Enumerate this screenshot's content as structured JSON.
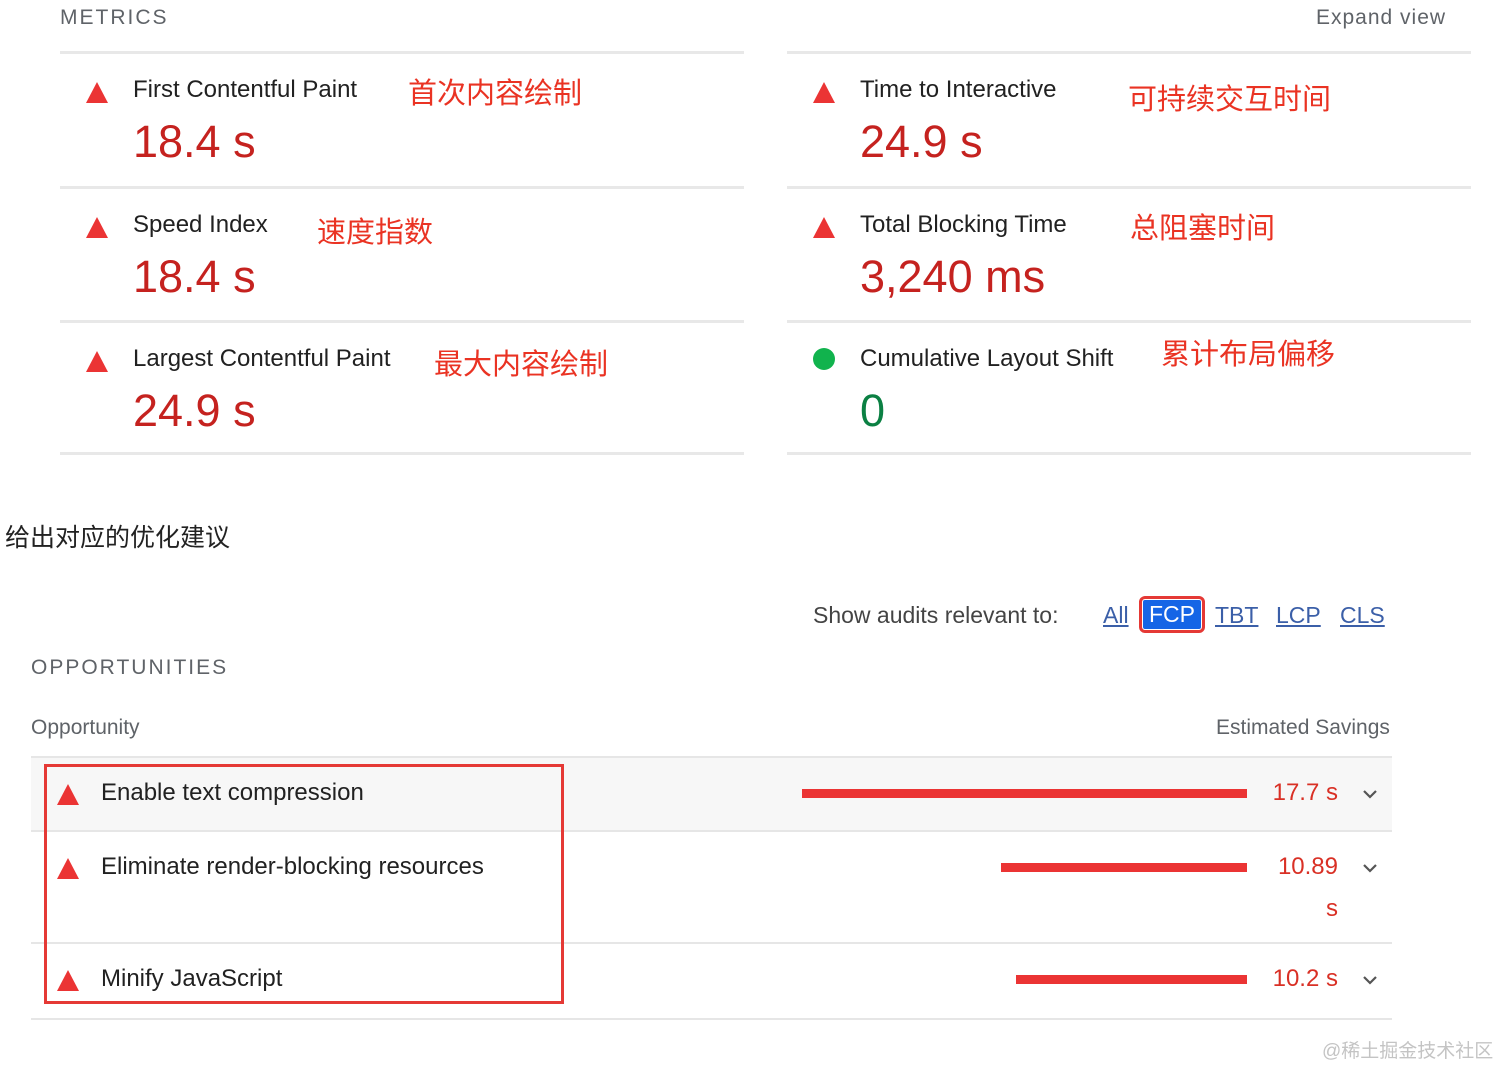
{
  "metrics_section": {
    "title": "METRICS",
    "expand_label": "Expand view",
    "items": [
      {
        "name": "First Contentful Paint",
        "value": "18.4 s",
        "status": "fail",
        "annotation": "首次内容绘制"
      },
      {
        "name": "Time to Interactive",
        "value": "24.9 s",
        "status": "fail",
        "annotation": "可持续交互时间"
      },
      {
        "name": "Speed Index",
        "value": "18.4 s",
        "status": "fail",
        "annotation": "速度指数"
      },
      {
        "name": "Total Blocking Time",
        "value": "3,240 ms",
        "status": "fail",
        "annotation": "总阻塞时间"
      },
      {
        "name": "Largest Contentful Paint",
        "value": "24.9 s",
        "status": "fail",
        "annotation": "最大内容绘制"
      },
      {
        "name": "Cumulative Layout Shift",
        "value": "0",
        "status": "pass",
        "annotation": "累计布局偏移"
      }
    ]
  },
  "note": "给出对应的优化建议",
  "audit_filter": {
    "label": "Show audits relevant to:",
    "options": [
      "All",
      "FCP",
      "TBT",
      "LCP",
      "CLS"
    ],
    "selected": "FCP"
  },
  "opportunities": {
    "title": "OPPORTUNITIES",
    "column_opportunity": "Opportunity",
    "column_savings": "Estimated Savings",
    "rows": [
      {
        "label": "Enable text compression",
        "savings": "17.7 s",
        "savings_value": 17.7
      },
      {
        "label": "Eliminate render-blocking resources",
        "savings": "10.89 s",
        "savings_value": 10.89
      },
      {
        "label": "Minify JavaScript",
        "savings": "10.2 s",
        "savings_value": 10.2
      }
    ]
  },
  "watermark": "@稀土掘金技术社区",
  "colors": {
    "fail": "#eb3434",
    "pass": "#11b34d",
    "annotation": "#ea3323",
    "filter_active": "#1565e6",
    "highlight": "#e53935"
  }
}
